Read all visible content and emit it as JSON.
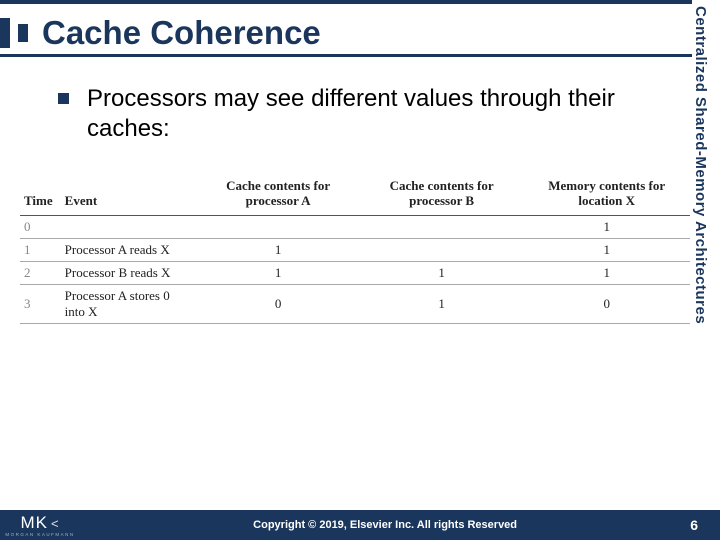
{
  "title": "Cache Coherence",
  "side_label": "Centralized Shared-Memory Architectures",
  "bullet": "Processors may see different values through their caches:",
  "table": {
    "headers": [
      "Time",
      "Event",
      "Cache contents for processor A",
      "Cache contents for processor B",
      "Memory contents for location X"
    ],
    "rows": [
      {
        "time": "0",
        "event": "",
        "a": "",
        "b": "",
        "mem": "1"
      },
      {
        "time": "1",
        "event": "Processor A reads X",
        "a": "1",
        "b": "",
        "mem": "1"
      },
      {
        "time": "2",
        "event": "Processor B reads X",
        "a": "1",
        "b": "1",
        "mem": "1"
      },
      {
        "time": "3",
        "event": "Processor A stores 0 into X",
        "a": "0",
        "b": "1",
        "mem": "0"
      }
    ]
  },
  "footer": {
    "logo_main": "MK",
    "logo_sub": "MORGAN KAUFMANN",
    "copyright": "Copyright © 2019, Elsevier Inc. All rights Reserved",
    "page": "6"
  }
}
